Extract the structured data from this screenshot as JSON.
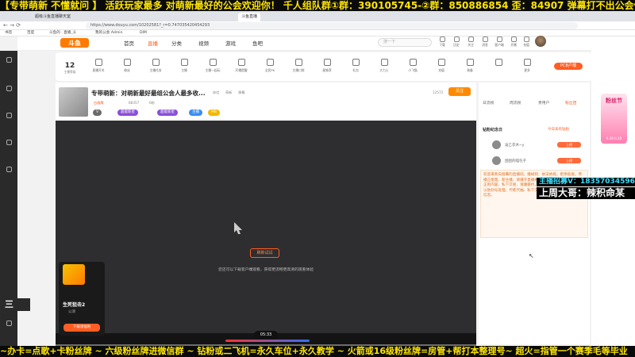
{
  "overlay": {
    "top_banner": "【专带萌新 不懂就问 】 活跃玩家最多 对萌新最好的公会欢迎你！ 千人组队群①群：390105745-②群：850886854  歪：84907  弹幕打不出公会俩字",
    "bottom_banner": "~办卡=点歌+卡粉丝牌 ~ 六级粉丝牌进微信群 ~ 钻粉或二飞机=永久车位+永久教学 ~ 火箭或16级粉丝牌=房管+帮打本整理号~ 超火=指管一个赛季毛等毕业",
    "streamer_line": "主播招募V：18357034596",
    "streamer_label": "上周大哥：辣积命某",
    "floating_text": "三"
  },
  "browser": {
    "tabs": [
      "超级斗鱼直播聊天室",
      "斗鱼直播"
    ],
    "url": "https://www.douyu.com/10202581?_r=0.747035420454293",
    "bookmarks": [
      "书签",
      "百度",
      "斗鱼的 · 直播_斗",
      "我的公会 Admin",
      "DIM"
    ]
  },
  "header": {
    "nav": [
      "首页",
      "直播",
      "分类",
      "视频",
      "游戏",
      "鱼吧"
    ],
    "active_nav": "直播",
    "search_placeholder": "搜一下",
    "icons": [
      "下载",
      "历史",
      "关注",
      "消息",
      "客户端",
      "开播",
      "充值"
    ]
  },
  "toolbar": {
    "level": "12",
    "level_label": "主播等级",
    "items": [
      "直播开关",
      "粉丝",
      "主播任务",
      "主播",
      "主播一起玩",
      "开播提醒",
      "全民PK",
      "主播口袋",
      "星推荐",
      "礼包",
      "大力士",
      "小飞猫",
      "充值",
      "装备",
      "更多"
    ],
    "pcb_label": "PCB户端"
  },
  "room": {
    "title": "专带萌新：对萌新最好最组公会人最多收...",
    "tags": [
      "体验",
      "萌新",
      "弹幕"
    ],
    "owner": "白眉鹰",
    "hot": "88357",
    "fans": "6粉",
    "follow_label": "关注",
    "badges": [
      "V",
      "超能新星",
      "超能新星",
      "主播",
      "MB"
    ],
    "count": "12572"
  },
  "video": {
    "refresh_label": "刷新试试",
    "hint": "您还可以下载客户端观看，获得更流畅更高清的观看体验",
    "time": "05:33",
    "promo_title": "生死狙击2",
    "promo_sub": "公测",
    "promo_btn": "下载领福利"
  },
  "side": {
    "tabs": [
      "日流榜",
      "周流榜",
      "贵用户",
      "粉丝团"
    ],
    "active_tab": "粉丝团",
    "fans_title": "钻粉纪念日",
    "fans_sub": "今日未有钻粉",
    "rows": [
      {
        "name": "凌乙衣木~y",
        "badge": "上榜"
      },
      {
        "name": "困困的喵包子",
        "badge": "上榜"
      }
    ],
    "chat": "欢迎来到白眉鹰的直播间。播规则：依法依规，拒绝低俗，传播正能量。新主播，请遵守直播规范，引导正确价值观。以上正则内容，私下交易、请遵循约，以防上当受骗。严禁低俗，以防封号处理。代练代抽、私下交易，网页礼包等，谨防诈骗信息。"
  },
  "right_rail": {
    "promo": "粉丝节",
    "promo_date": "9.26-9.30"
  }
}
